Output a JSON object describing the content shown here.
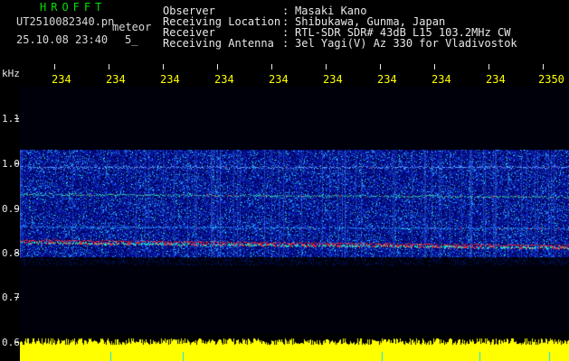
{
  "header": {
    "software_name": "HROFFT",
    "filename": "UT2510082340.pn",
    "mode_label": "meteor",
    "datetime": "25.10.08 23:40",
    "interval": "5_",
    "fields": [
      {
        "label": "Observer",
        "value": "Masaki Kano"
      },
      {
        "label": "Receiving Location",
        "value": "Shibukawa, Gunma, Japan"
      },
      {
        "label": "Receiver",
        "value": "RTL-SDR SDR# 43dB L15 103.2MHz CW"
      },
      {
        "label": "Receiving Antenna",
        "value": "3el Yagi(V) Az 330 for Vladivostok"
      }
    ]
  },
  "axes": {
    "y_unit": "kHz",
    "y_labels": [
      "1.1",
      "1.0",
      "0.9",
      "0.8",
      "0.7",
      "0.6"
    ],
    "x_labels": [
      "234",
      "234",
      "234",
      "234",
      "234",
      "234",
      "234",
      "234",
      "234",
      "2350"
    ]
  },
  "colors": {
    "background": "#000000",
    "header_text": "#e8e8e8",
    "title_green": "#00e000",
    "time_labels": "#ffff00",
    "noise_strong": "#ff2020",
    "noise_mid": "#30e0a0",
    "noise_low": "#2040ff",
    "baseline": "#ffff00"
  }
}
